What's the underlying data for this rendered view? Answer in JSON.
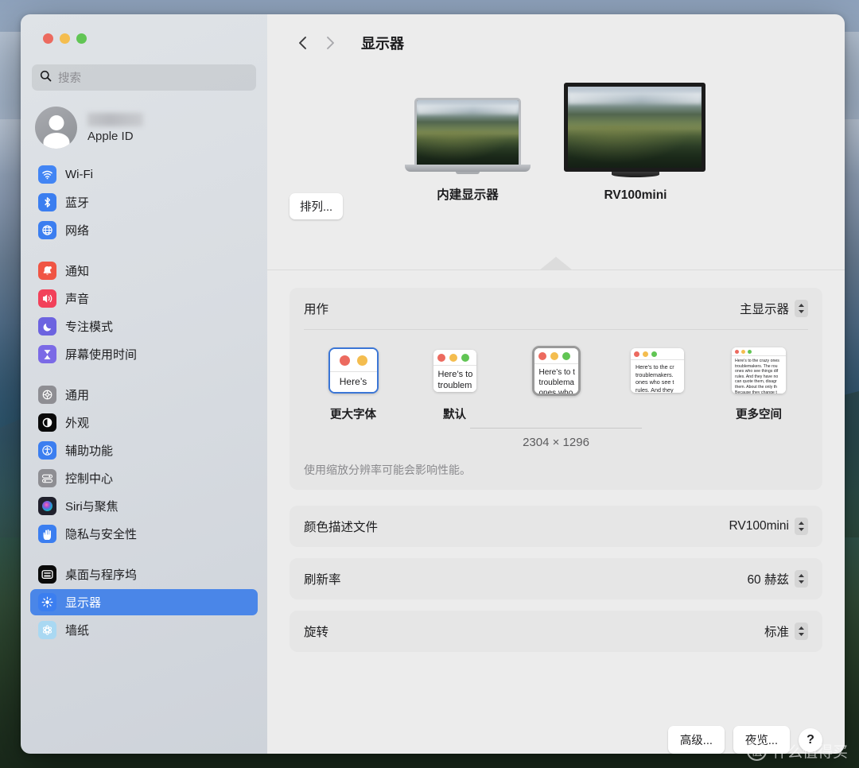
{
  "window": {
    "traffic_lights": [
      {
        "name": "close",
        "color": "#ec6a5f"
      },
      {
        "name": "minimize",
        "color": "#f4bd4f"
      },
      {
        "name": "zoom",
        "color": "#61c554"
      }
    ]
  },
  "sidebar": {
    "search": {
      "placeholder": "搜索",
      "value": ""
    },
    "account": {
      "name_redacted": "",
      "subtitle": "Apple ID"
    },
    "groups": [
      {
        "items": [
          {
            "label": "Wi-Fi",
            "icon": "wifi-icon",
            "color": "#4285f4",
            "active": false
          },
          {
            "label": "蓝牙",
            "icon": "bluetooth-icon",
            "color": "#3b7ef0",
            "active": false
          },
          {
            "label": "网络",
            "icon": "globe-icon",
            "color": "#3b7ef0",
            "active": false
          }
        ]
      },
      {
        "items": [
          {
            "label": "通知",
            "icon": "bell-icon",
            "color": "#f05544",
            "active": false
          },
          {
            "label": "声音",
            "icon": "speaker-icon",
            "color": "#f2415a",
            "active": false
          },
          {
            "label": "专注模式",
            "icon": "moon-icon",
            "color": "#6c63e0",
            "active": false
          },
          {
            "label": "屏幕使用时间",
            "icon": "hourglass-icon",
            "color": "#7b6ae6",
            "active": false
          }
        ]
      },
      {
        "items": [
          {
            "label": "通用",
            "icon": "gear-icon",
            "color": "#8e8e93",
            "active": false
          },
          {
            "label": "外观",
            "icon": "appearance-icon",
            "color": "#0a0a0a",
            "active": false
          },
          {
            "label": "辅助功能",
            "icon": "accessibility-icon",
            "color": "#3b7ef0",
            "active": false
          },
          {
            "label": "控制中心",
            "icon": "control-center-icon",
            "color": "#8e8e93",
            "active": false
          },
          {
            "label": "Siri与聚焦",
            "icon": "siri-icon",
            "color": "#2b2b3a",
            "active": false
          },
          {
            "label": "隐私与安全性",
            "icon": "privacy-hand-icon",
            "color": "#3b7ef0",
            "active": false
          }
        ]
      },
      {
        "items": [
          {
            "label": "桌面与程序坞",
            "icon": "desktop-dock-icon",
            "color": "#0a0a0a",
            "active": false
          },
          {
            "label": "显示器",
            "icon": "brightness-icon",
            "color": "#3b7ef0",
            "active": true
          },
          {
            "label": "墙纸",
            "icon": "wallpaper-icon",
            "color": "#a9d8f2",
            "active": false
          }
        ]
      }
    ]
  },
  "toolbar": {
    "back_icon": "chevron-left-icon",
    "forward_icon": "chevron-right-icon",
    "title": "显示器"
  },
  "displays": {
    "arrange_button": "排列...",
    "items": [
      {
        "name": "内建显示器",
        "type": "laptop",
        "selected": false
      },
      {
        "name": "RV100mini",
        "type": "monitor",
        "selected": true
      }
    ]
  },
  "use_as": {
    "label": "用作",
    "value": "主显示器",
    "stepper_icon": "stepper-updown-icon"
  },
  "resolutions": {
    "options": [
      {
        "label": "更大字体",
        "selected": false,
        "state": "blue-outline",
        "size": "xsmall",
        "preview_text": "Here's"
      },
      {
        "label": "默认",
        "selected": false,
        "state": "plain",
        "size": "small",
        "preview_text": "Here's to\ntroublem"
      },
      {
        "label": "",
        "selected": true,
        "state": "gray-outline",
        "size": "medium",
        "preview_text": "Here's to t\ntroublema\nones who"
      },
      {
        "label": "",
        "selected": false,
        "state": "plain",
        "size": "large",
        "preview_text": "Here's to the cr\ntroublemakers.\nones who see t\nrules. And they"
      },
      {
        "label": "更多空间",
        "selected": false,
        "state": "plain",
        "size": "xlarge",
        "preview_text": "Here's to the crazy ones\ntroublemakers. The rou\nones who see things dif\nrules. And they have no\ncan quote them, disagr\nthem. About the only th\nBecause they change t"
      }
    ],
    "selected_resolution": "2304 × 1296",
    "note": "使用缩放分辨率可能会影响性能。"
  },
  "settings_rows": [
    {
      "label": "颜色描述文件",
      "value": "RV100mini",
      "stepper_icon": "stepper-updown-icon"
    },
    {
      "label": "刷新率",
      "value": "60 赫兹",
      "stepper_icon": "stepper-updown-icon"
    },
    {
      "label": "旋转",
      "value": "标准",
      "stepper_icon": "stepper-updown-icon"
    }
  ],
  "footer": {
    "advanced_button": "高级...",
    "nightshift_button": "夜览...",
    "help_button": "?"
  },
  "watermark": {
    "badge": "值",
    "text": "什么值得买"
  },
  "colors": {
    "accent": "#4a86e8",
    "selection_blue": "#3b76d6",
    "window_bg": "#ececec",
    "card_bg": "#e6e6e6"
  }
}
